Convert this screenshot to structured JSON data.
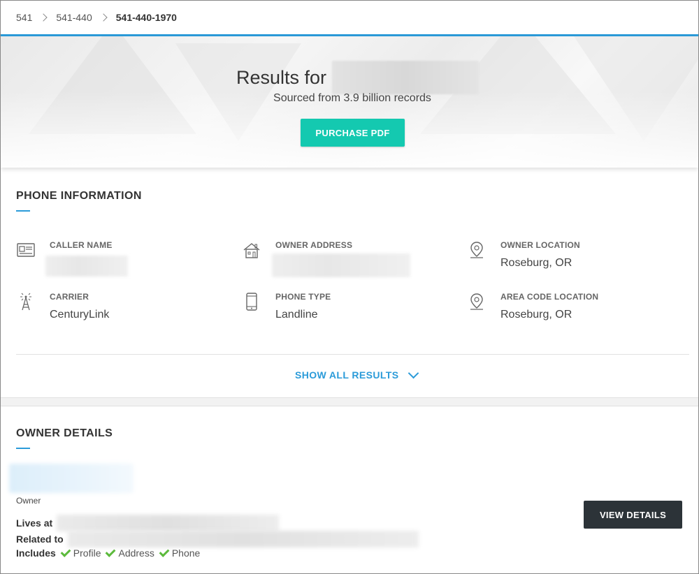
{
  "breadcrumb": [
    "541",
    "541-440",
    "541-440-1970"
  ],
  "hero": {
    "title_prefix": "Results for",
    "subtitle": "Sourced from 3.9 billion records",
    "purchase_label": "PURCHASE PDF"
  },
  "phone_info": {
    "heading": "PHONE INFORMATION",
    "items": [
      {
        "label": "CALLER NAME",
        "value": "",
        "icon": "id-card-icon"
      },
      {
        "label": "OWNER ADDRESS",
        "value": "",
        "icon": "house-icon"
      },
      {
        "label": "OWNER LOCATION",
        "value": "Roseburg, OR",
        "icon": "location-pin-icon"
      },
      {
        "label": "CARRIER",
        "value": "CenturyLink",
        "icon": "cell-tower-icon"
      },
      {
        "label": "PHONE TYPE",
        "value": "Landline",
        "icon": "phone-icon"
      },
      {
        "label": "AREA CODE LOCATION",
        "value": "Roseburg, OR",
        "icon": "location-pin-icon"
      }
    ],
    "show_all_label": "SHOW ALL RESULTS"
  },
  "owner": {
    "heading": "OWNER DETAILS",
    "role": "Owner",
    "lives_at_label": "Lives at",
    "related_to_label": "Related to",
    "includes_label": "Includes",
    "includes": [
      "Profile",
      "Address",
      "Phone"
    ],
    "view_details_label": "VIEW DETAILS"
  },
  "colors": {
    "accent": "#2b9bd9",
    "teal_button": "#14c9b0",
    "dark_button": "#2c3338",
    "check": "#5cba3c"
  }
}
